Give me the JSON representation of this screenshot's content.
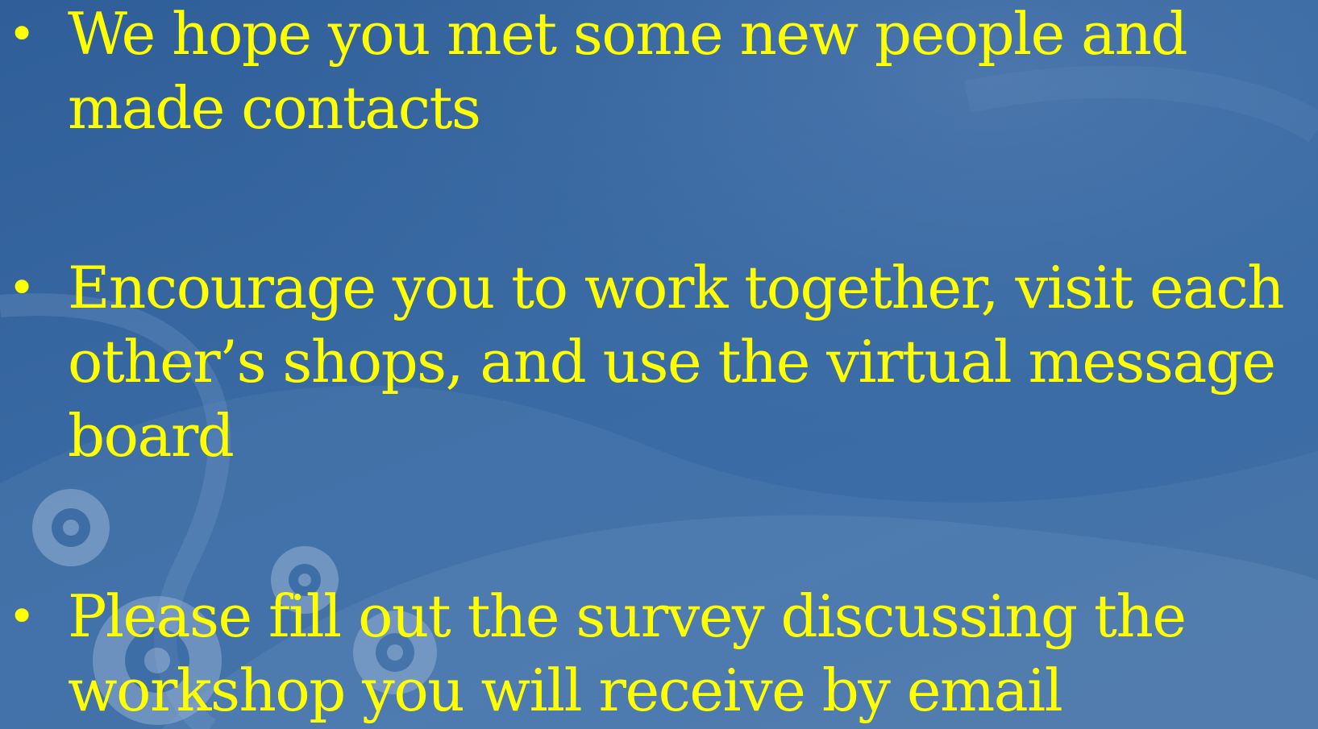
{
  "colors": {
    "background": "#3a6aa3",
    "text": "#ffff00"
  },
  "slide": {
    "bullets": [
      {
        "marker": "•",
        "lines": [
          "We hope you met some new people and",
          "made contacts"
        ]
      },
      {
        "marker": "•",
        "lines": [
          "Encourage you to work together, visit each",
          "other’s shops, and use the virtual message",
          "board"
        ]
      },
      {
        "marker": "•",
        "lines": [
          "Please fill out the survey discussing the",
          "workshop you will receive by email"
        ]
      }
    ]
  }
}
